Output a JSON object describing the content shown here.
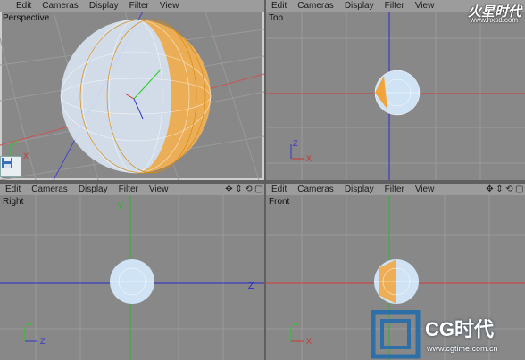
{
  "menu": {
    "edit": "Edit",
    "cameras": "Cameras",
    "display": "Display",
    "filter": "Filter",
    "view": "View"
  },
  "viewports": {
    "perspective": {
      "label": "Perspective"
    },
    "top": {
      "label": "Top"
    },
    "right": {
      "label": "Right"
    },
    "front": {
      "label": "Front"
    }
  },
  "axes": {
    "x": "X",
    "y": "Y",
    "z": "Z"
  },
  "toolbar_icons": [
    "move-view-icon",
    "zoom-view-icon",
    "rotate-view-icon",
    "maximize-view-icon"
  ],
  "watermarks": {
    "top_brand": "火星时代",
    "top_url": "www.hxsd.com",
    "bottom_brand": "CG时代",
    "bottom_url": "www.cgtime.com.cn"
  },
  "colors": {
    "viewport_bg": "#888888",
    "grid": "#9a9a9a",
    "axis_red": "#d43a3a",
    "axis_blue": "#2a2ad0",
    "axis_green": "#2cb52c",
    "sphere_orange": "#f2a43a",
    "sphere_blue": "#cfe3f5"
  }
}
